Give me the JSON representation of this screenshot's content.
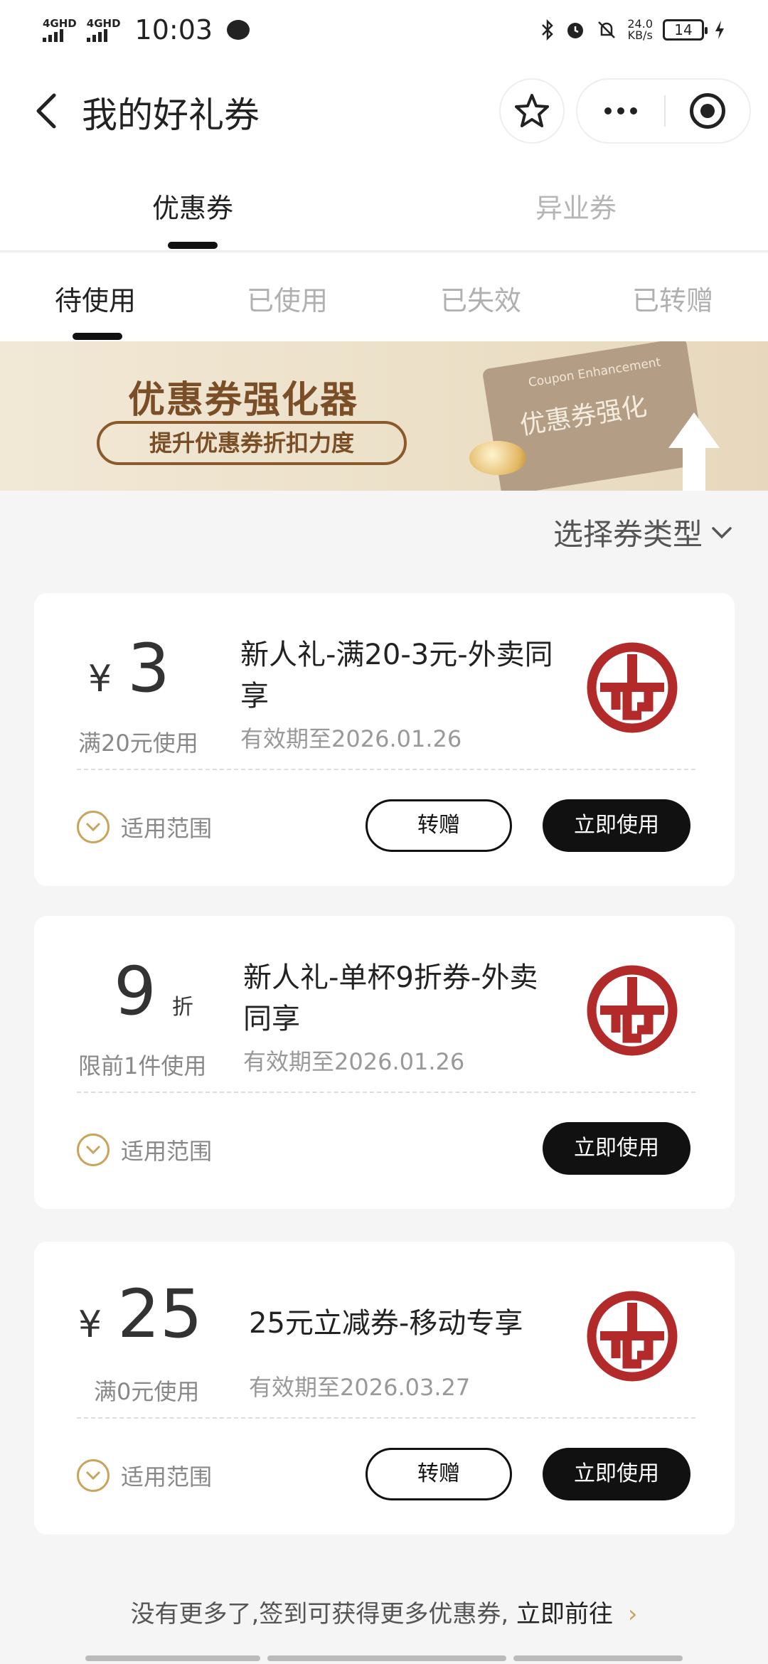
{
  "status_bar": {
    "net1": "4GHD",
    "net2": "4GHD",
    "time": "10:03",
    "speed_value": "24.0",
    "speed_unit": "KB/s",
    "battery": "14"
  },
  "nav": {
    "title": "我的好礼券",
    "icons": [
      "back-arrow-icon",
      "star-icon",
      "more-icon",
      "target-icon"
    ]
  },
  "main_tabs": [
    {
      "label": "优惠券",
      "active": true
    },
    {
      "label": "异业券",
      "active": false
    }
  ],
  "sub_tabs": [
    {
      "label": "待使用",
      "active": true
    },
    {
      "label": "已使用",
      "active": false
    },
    {
      "label": "已失效",
      "active": false
    },
    {
      "label": "已转赠",
      "active": false
    }
  ],
  "banner": {
    "title": "优惠券强化器",
    "subtitle": "提升优惠券折扣力度",
    "card_en": "Coupon Enhancement",
    "card_cn": "优惠券强化"
  },
  "filter": {
    "label": "选择券类型"
  },
  "coupons": [
    {
      "currency": "¥",
      "value": "3",
      "condition": "满20元使用",
      "title": "新人礼-满20-3元-外卖同享",
      "validity": "有效期至2026.01.26",
      "scope": "适用范围",
      "transfer": "转赠",
      "use": "立即使用"
    },
    {
      "value": "9",
      "unit": "折",
      "condition": "限前1件使用",
      "title": "新人礼-单杯9折券-外卖同享",
      "validity": "有效期至2026.01.26",
      "scope": "适用范围",
      "use": "立即使用"
    },
    {
      "currency": "¥",
      "value": "25",
      "condition": "满0元使用",
      "title": "25元立减券-移动专享",
      "validity": "有效期至2026.03.27",
      "scope": "适用范围",
      "transfer": "转赠",
      "use": "立即使用"
    }
  ],
  "footer": {
    "text": "没有更多了,签到可获得更多优惠券,",
    "link": "立即前往",
    "arrow": "›"
  },
  "colors": {
    "accent_gold": "#c9a45c",
    "brand_red": "#b22a2a",
    "dark_button": "#111111"
  }
}
